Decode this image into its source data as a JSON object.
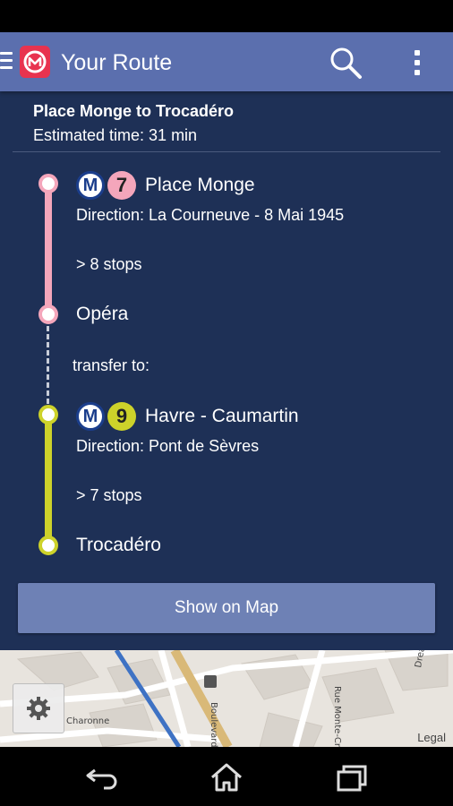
{
  "app_bar": {
    "title": "Your Route",
    "logo_icon": "metro-logo-icon",
    "menu_icon": "hamburger-menu-icon",
    "search_icon": "search-icon",
    "overflow_icon": "overflow-menu-icon",
    "background_color": "#5b6fae"
  },
  "route": {
    "name": "Place Monge to Trocadéro",
    "estimated_time": "Estimated time: 31 min",
    "background_color": "#1e3056"
  },
  "legs": [
    {
      "metro_letter": "M",
      "line_number": "7",
      "line_color": "#f4a6bb",
      "start_station": "Place Monge",
      "direction": "Direction: La Courneuve - 8 Mai 1945",
      "stops": "> 8 stops",
      "end_station": "Opéra"
    },
    {
      "metro_letter": "M",
      "line_number": "9",
      "line_color": "#cdd22a",
      "start_station": "Havre - Caumartin",
      "direction": "Direction: Pont de Sèvres",
      "stops": "> 7 stops",
      "end_station": "Trocadéro"
    }
  ],
  "transfer_label": "transfer to:",
  "show_map_button": "Show on Map",
  "map": {
    "street_labels": [
      "Charonne",
      "Boulevard",
      "Rue Monte-Cris",
      "Drea"
    ],
    "settings_icon": "gear-icon",
    "legal_link": "Legal"
  },
  "nav_bar": {
    "back_icon": "back-icon",
    "home_icon": "home-icon",
    "recents_icon": "recent-apps-icon"
  }
}
